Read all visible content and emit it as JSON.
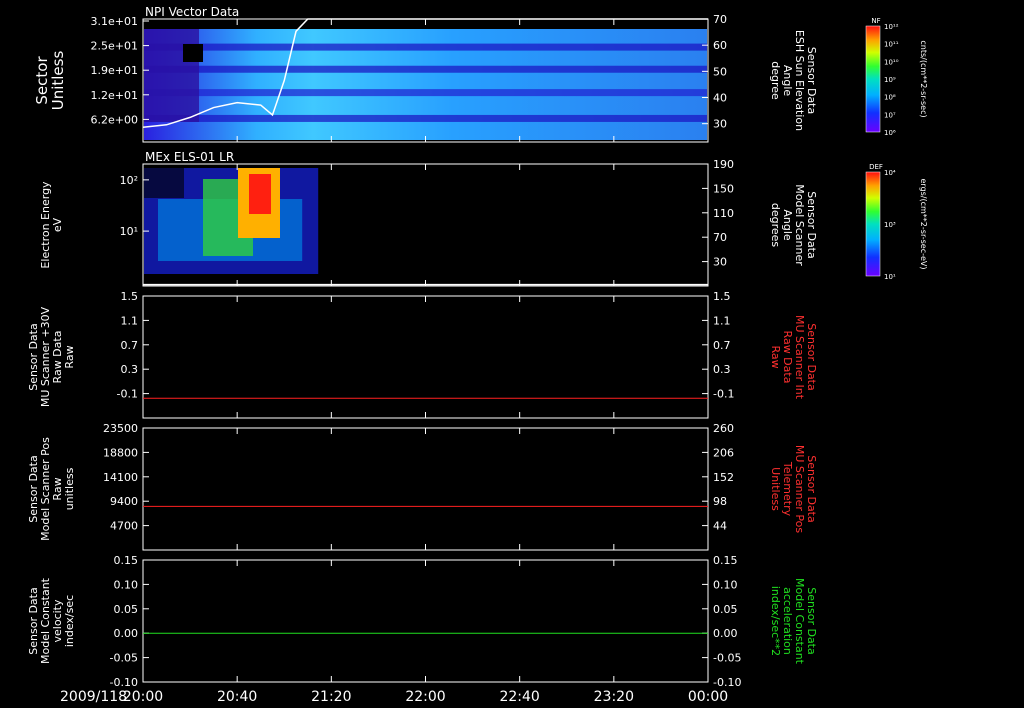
{
  "date_label": "2009/118",
  "time_ticks": [
    "20:00",
    "20:40",
    "21:20",
    "22:00",
    "22:40",
    "23:20",
    "00:00"
  ],
  "colorbars": [
    {
      "title": "NF",
      "units": "cnts/(cm**2-sr-sec)",
      "labels": [
        "10¹²",
        "10¹¹",
        "10¹⁰",
        "10⁹",
        "10⁸",
        "10⁷",
        "10⁶"
      ]
    },
    {
      "title": "DEF",
      "units": "ergs/(cm**2-sr-sec-eV)",
      "labels": [
        "10⁴",
        "10³",
        "10¹"
      ]
    }
  ],
  "chart_data": [
    {
      "type": "heatmap",
      "title": "NPI Vector Data",
      "ylabel": [
        "Sector",
        "Unitless"
      ],
      "y_ticks": [
        "3.1e+01",
        "2.5e+01",
        "1.9e+01",
        "1.2e+01",
        "6.2e+00"
      ],
      "y2label": [
        "Sensor Data",
        "ESH Sun Elevation",
        "Angle",
        "degree"
      ],
      "y2_ticks": [
        "70",
        "60",
        "50",
        "40",
        "30"
      ],
      "y2lim": [
        20,
        70
      ],
      "overlay_line": {
        "x_minutes": [
          0,
          10,
          20,
          30,
          40,
          50,
          55,
          60,
          65,
          70,
          280
        ],
        "y": [
          26,
          27,
          30,
          34,
          36,
          35,
          31,
          45,
          65,
          70,
          70
        ],
        "color": "#ffffff"
      }
    },
    {
      "type": "heatmap",
      "title": "MEx ELS-01 LR",
      "ylabel": [
        "Electron Energy",
        "eV"
      ],
      "y_ticks": [
        "10²",
        "10¹"
      ],
      "y2label": [
        "Sensor Data",
        "Model Scanner",
        "Angle",
        "degrees"
      ],
      "y2_ticks": [
        "190",
        "150",
        "110",
        "70",
        "30"
      ],
      "y2lim": [
        10,
        190
      ],
      "overlay_line": {
        "x_minutes": [
          0,
          280
        ],
        "y": [
          12,
          12
        ],
        "color": "#ffffff"
      }
    },
    {
      "type": "line",
      "ylabel": [
        "Sensor Data",
        "MU Scanner +30V",
        "Raw Data",
        "Raw"
      ],
      "y_ticks": [
        "1.5",
        "1.1",
        "0.7",
        "0.3",
        "-0.1"
      ],
      "ylim": [
        -0.35,
        1.5
      ],
      "y2label": [
        "Sensor Data",
        "MU Scanner Int",
        "Raw Data",
        "Raw"
      ],
      "y2_ticks": [
        "1.5",
        "1.1",
        "0.7",
        "0.3",
        "-0.1"
      ],
      "series": [
        {
          "x_minutes": [
            0,
            280
          ],
          "y": [
            -0.05,
            -0.05
          ],
          "color": "#ff2020"
        }
      ]
    },
    {
      "type": "line",
      "ylabel": [
        "Sensor Data",
        "Model Scanner Pos",
        "Raw",
        "unitless"
      ],
      "y_ticks": [
        "23500",
        "18800",
        "14100",
        "9400",
        "4700"
      ],
      "ylim": [
        0,
        23500
      ],
      "y2label": [
        "Sensor Data",
        "MU Scanner Pos",
        "Telemetry",
        "Unitless"
      ],
      "y2_ticks": [
        "260",
        "206",
        "152",
        "98",
        "44"
      ],
      "series": [
        {
          "x_minutes": [
            0,
            280
          ],
          "y": [
            8400,
            8400
          ],
          "color": "#ff2020"
        }
      ]
    },
    {
      "type": "line",
      "ylabel": [
        "Sensor Data",
        "Model Constant",
        "velocity",
        "index/sec"
      ],
      "y_ticks": [
        "0.15",
        "0.10",
        "0.05",
        "0.00",
        "-0.05",
        "-0.10"
      ],
      "ylim": [
        -0.1,
        0.15
      ],
      "y2label": [
        "Sensor Data",
        "Model Constant",
        "acceleration",
        "index/sec**2"
      ],
      "y2_ticks": [
        "0.15",
        "0.10",
        "0.05",
        "0.00",
        "-0.05",
        "-0.10"
      ],
      "series": [
        {
          "x_minutes": [
            0,
            280
          ],
          "y": [
            0.0,
            0.0
          ],
          "color": "#20e020"
        }
      ]
    }
  ]
}
